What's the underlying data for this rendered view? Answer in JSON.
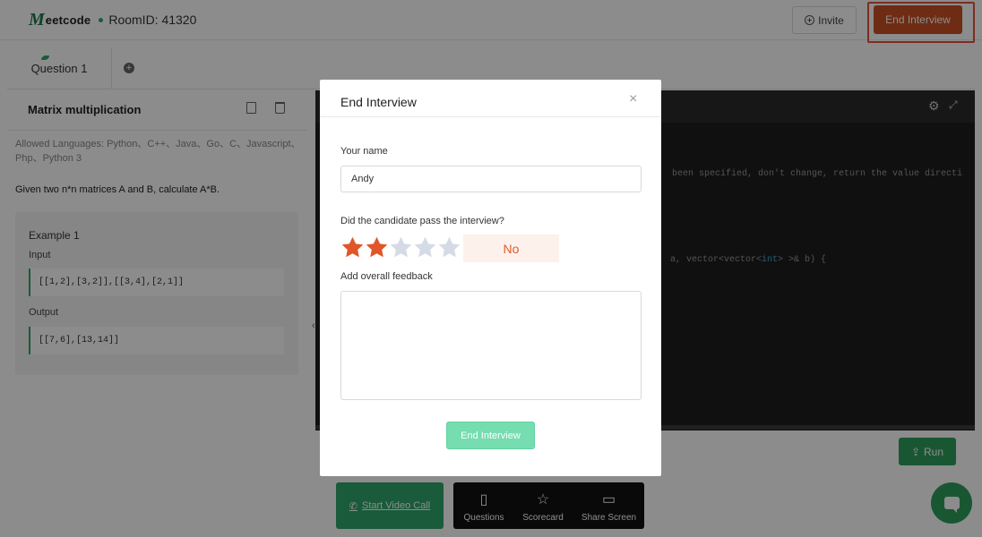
{
  "header": {
    "logo_text": "eetcode",
    "logo_mark": "M",
    "room_id": "RoomID: 41320",
    "invite_label": "Invite",
    "end_interview_label": "End Interview"
  },
  "tabs": {
    "question_label": "Question 1",
    "add_symbol": "+"
  },
  "problem": {
    "title": "Matrix multiplication",
    "languages": "Allowed Languages: Python、C++、Java、Go、C、Javascript、Php、Python 3",
    "description": "Given two n*n matrices A and B, calculate A*B.",
    "example": {
      "title": "Example 1",
      "input_label": "Input",
      "input_value": "[[1,2],[3,2]],[[3,4],[2,1]]",
      "output_label": "Output",
      "output_value": "[[7,6],[13,14]]"
    },
    "collapse_symbol": "‹"
  },
  "editor": {
    "line_1": "been specified, don't change, return the value directi",
    "line_2_pre": "a, vector<vector<",
    "line_2_kw": "int",
    "line_2_post": "> >& b) {",
    "run_label": "Run"
  },
  "dock": {
    "video_call_label": "Start Video Call",
    "items": [
      {
        "label": "Questions",
        "icon": "book-icon"
      },
      {
        "label": "Scorecard",
        "icon": "star-icon"
      },
      {
        "label": "Share Screen",
        "icon": "screen-icon"
      }
    ]
  },
  "modal": {
    "title": "End Interview",
    "close_symbol": "×",
    "name_label": "Your name",
    "name_value": "Andy",
    "pass_question": "Did the candidate pass the interview?",
    "rating": 2,
    "rating_max": 5,
    "pass_result": "No",
    "feedback_label": "Add overall feedback",
    "feedback_value": "",
    "submit_label": "End Interview"
  },
  "colors": {
    "accent_green": "#2ea66b",
    "end_orange": "#c65024",
    "star_filled": "#e0562a",
    "star_empty": "#d5dbe6"
  }
}
